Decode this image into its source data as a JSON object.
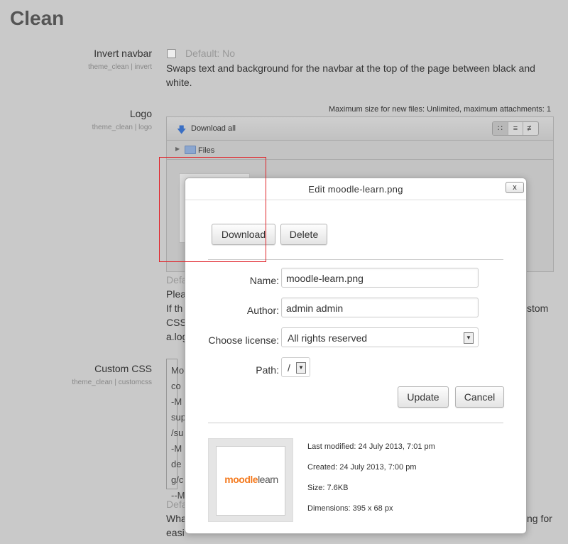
{
  "page": {
    "title": "Clean"
  },
  "invert_navbar": {
    "label": "Invert navbar",
    "sublabel": "theme_clean | invert",
    "default": "Default: No",
    "description": "Swaps text and background for the navbar at the top of the page between black and white."
  },
  "logo": {
    "label": "Logo",
    "sublabel": "theme_clean | logo",
    "max_size": "Maximum size for new files: Unlimited, maximum attachments: 1",
    "download_all": "Download all",
    "files_path": "Files",
    "view_icons": [
      "grid-view-icon",
      "list-view-icon",
      "tree-view-icon"
    ],
    "behind_text": {
      "l1": "Defa",
      "l2": "Plea",
      "l3": "If th",
      "l3_right": "stom",
      "l4": "CSS",
      "l5": "a.log"
    }
  },
  "custom_css": {
    "label": "Custom CSS",
    "sublabel": "theme_clean | customcss",
    "content_lines": [
      "Mo",
      "co",
      "-M",
      "sup",
      "/su",
      "-M",
      "de",
      "g/c",
      "--M"
    ],
    "behind_text": {
      "l1": "Defa",
      "l2": "Wha",
      "l2_right": "ng for",
      "l3": "easi"
    }
  },
  "dialog": {
    "title": "Edit moodle-learn.png",
    "close_label": "x",
    "download_button": "Download",
    "delete_button": "Delete",
    "name_label": "Name:",
    "name_value": "moodle-learn.png",
    "author_label": "Author:",
    "author_value": "admin admin",
    "license_label": "Choose license:",
    "license_value": "All rights reserved",
    "path_label": "Path:",
    "path_value": "/",
    "update_button": "Update",
    "cancel_button": "Cancel",
    "preview_logo": {
      "part1": "moodle",
      "part2": "learn"
    },
    "last_modified": "Last modified: 24 July 2013, 7:01 pm",
    "created": "Created: 24 July 2013, 7:00 pm",
    "size": "Size: 7.6KB",
    "dimensions": "Dimensions: 395 x 68 px"
  },
  "colors": {
    "highlight": "#e0242a",
    "logo_orange": "#f47b20"
  }
}
